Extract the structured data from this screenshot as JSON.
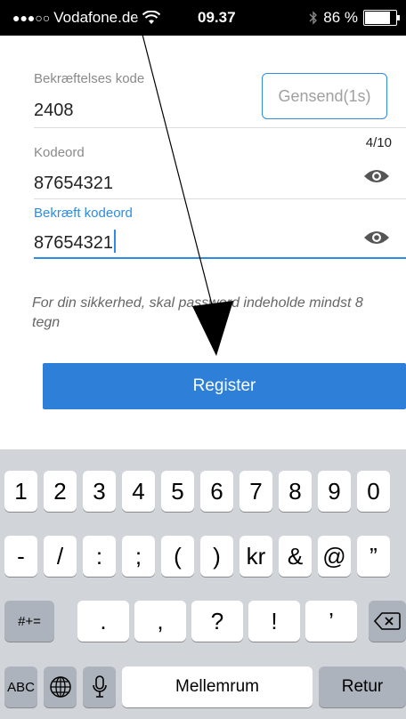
{
  "status_bar": {
    "signal_dots": "●●●○○",
    "carrier": "Vodafone.de",
    "time": "09.37",
    "battery": "86 %",
    "battery_level": 0.86
  },
  "form": {
    "code_label": "Bekræftelses kode",
    "code_value": "2408",
    "resend_label": "Gensend(1s)",
    "password_label": "Kodeord",
    "password_counter": "4/10",
    "password_value": "87654321",
    "confirm_label": "Bekræft kodeord",
    "confirm_value": "87654321",
    "note": "For din sikkerhed, skal password indeholde mindst 8 tegn",
    "register_label": "Register"
  },
  "keyboard": {
    "row1": [
      "1",
      "2",
      "3",
      "4",
      "5",
      "6",
      "7",
      "8",
      "9",
      "0"
    ],
    "row2": [
      "-",
      "/",
      ":",
      ";",
      "(",
      ")",
      "kr",
      "&",
      "@",
      "”"
    ],
    "row3_switch": "#+=",
    "row3": [
      ".",
      ",",
      "?",
      "!",
      "’"
    ],
    "abc": "ABC",
    "space": "Mellemrum",
    "return": "Retur"
  },
  "colors": {
    "accent": "#2d8de5",
    "button": "#2d7fd8"
  }
}
